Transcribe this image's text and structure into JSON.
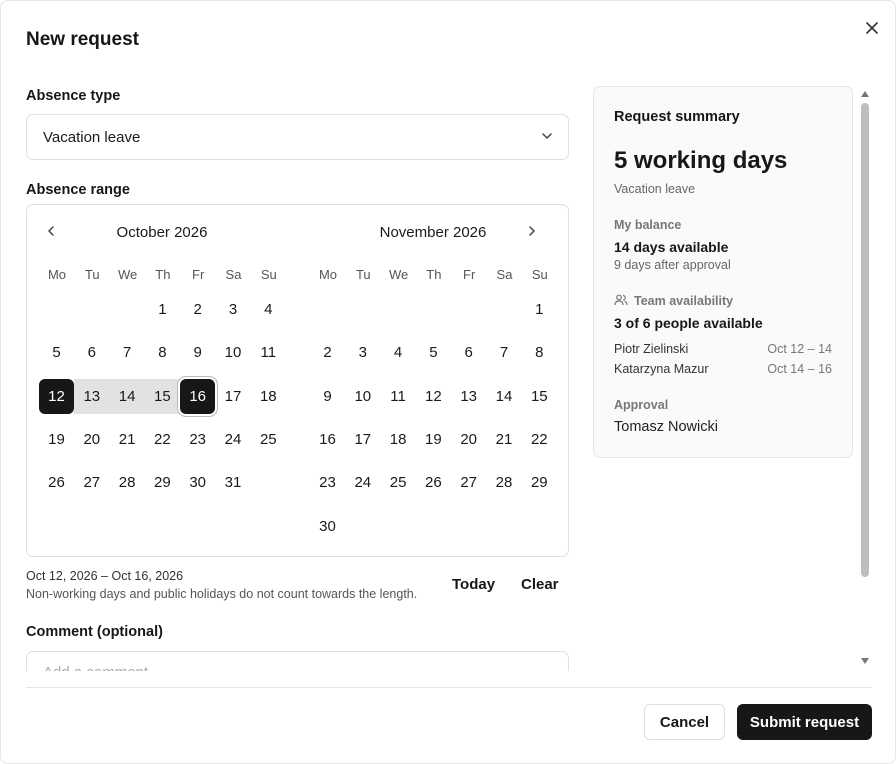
{
  "dialog": {
    "title": "New request"
  },
  "form": {
    "absence_type_label": "Absence type",
    "absence_type_value": "Vacation leave",
    "absence_range_label": "Absence range",
    "range_text": "Oct 12, 2026 – Oct 16, 2026",
    "hint": "Non-working days and public holidays do not count towards the length.",
    "today_label": "Today",
    "clear_label": "Clear",
    "comment_label": "Comment (optional)",
    "comment_placeholder": "Add a comment"
  },
  "calendar": {
    "weekdays": [
      "Mo",
      "Tu",
      "We",
      "Th",
      "Fr",
      "Sa",
      "Su"
    ],
    "months": [
      {
        "title": "October 2026",
        "weeks": [
          [
            "",
            "",
            "",
            "1",
            "2",
            "3",
            "4"
          ],
          [
            "5",
            "6",
            "7",
            "8",
            "9",
            "10",
            "11"
          ],
          [
            "12",
            "13",
            "14",
            "15",
            "16",
            "17",
            "18"
          ],
          [
            "19",
            "20",
            "21",
            "22",
            "23",
            "24",
            "25"
          ],
          [
            "26",
            "27",
            "28",
            "29",
            "30",
            "31",
            ""
          ]
        ]
      },
      {
        "title": "November 2026",
        "weeks": [
          [
            "",
            "",
            "",
            "",
            "",
            "",
            "1"
          ],
          [
            "2",
            "3",
            "4",
            "5",
            "6",
            "7",
            "8"
          ],
          [
            "9",
            "10",
            "11",
            "12",
            "13",
            "14",
            "15"
          ],
          [
            "16",
            "17",
            "18",
            "19",
            "20",
            "21",
            "22"
          ],
          [
            "23",
            "24",
            "25",
            "26",
            "27",
            "28",
            "29"
          ],
          [
            "30",
            "",
            "",
            "",
            "",
            "",
            ""
          ]
        ]
      }
    ],
    "selection": {
      "start": "12",
      "end": "16",
      "month": "October 2026"
    },
    "prev_icon": "chevron-left-icon",
    "next_icon": "chevron-right-icon"
  },
  "summary": {
    "heading": "Request summary",
    "length": "5 working days",
    "type": "Vacation leave",
    "balance_label": "My balance",
    "balance_value": "14 days available",
    "balance_after": "9 days after approval",
    "team_label": "Team availability",
    "team_icon": "users-icon",
    "team_value": "3 of 6 people available",
    "people": [
      {
        "name": "Piotr Zielinski",
        "dates": "Oct 12 – 14"
      },
      {
        "name": "Katarzyna Mazur",
        "dates": "Oct 14 – 16"
      }
    ],
    "approval_label": "Approval",
    "approver": "Tomasz Nowicki"
  },
  "footer": {
    "cancel_label": "Cancel",
    "submit_label": "Submit request"
  },
  "colors": {
    "primary": "#171717",
    "range_fill": "#e2e2e2",
    "border": "#e0e0e0",
    "panel_bg": "#fafafa"
  }
}
